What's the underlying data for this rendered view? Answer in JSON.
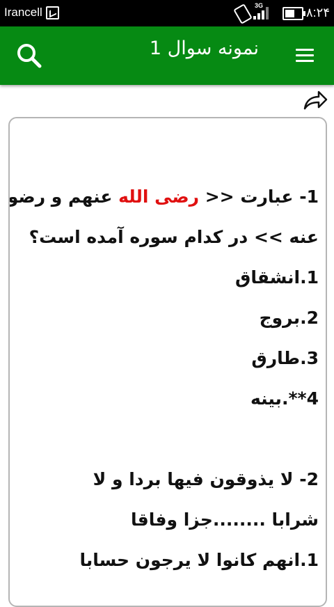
{
  "status": {
    "carrier": "Irancell",
    "network": "3G",
    "time": "۸:۲۴",
    "battery_level": 0.6
  },
  "appbar": {
    "title": "نمونه سوال 1",
    "background": "#068a13"
  },
  "content": {
    "q1_line1_part1": "1- عبارت << ",
    "q1_line1_highlight": "رضی الله",
    "q1_line1_part2": " عنهم و رضوا",
    "q1_line2": "عنه >> در کدام سوره آمده است؟",
    "q1_options": [
      "1.انشقاق",
      "2.بروج",
      "3.طارق",
      "4**.بینه"
    ],
    "q2_line1": "2- لا یذوقون فیها بردا و لا",
    "q2_line2": "شرابا ........جزا وفاقا",
    "q2_option1": "1.انهم کانوا لا یرجون حسابا",
    "highlight_color": "#e01010"
  },
  "icons": {
    "search": "search-icon",
    "menu": "menu-icon",
    "share": "share-icon"
  }
}
